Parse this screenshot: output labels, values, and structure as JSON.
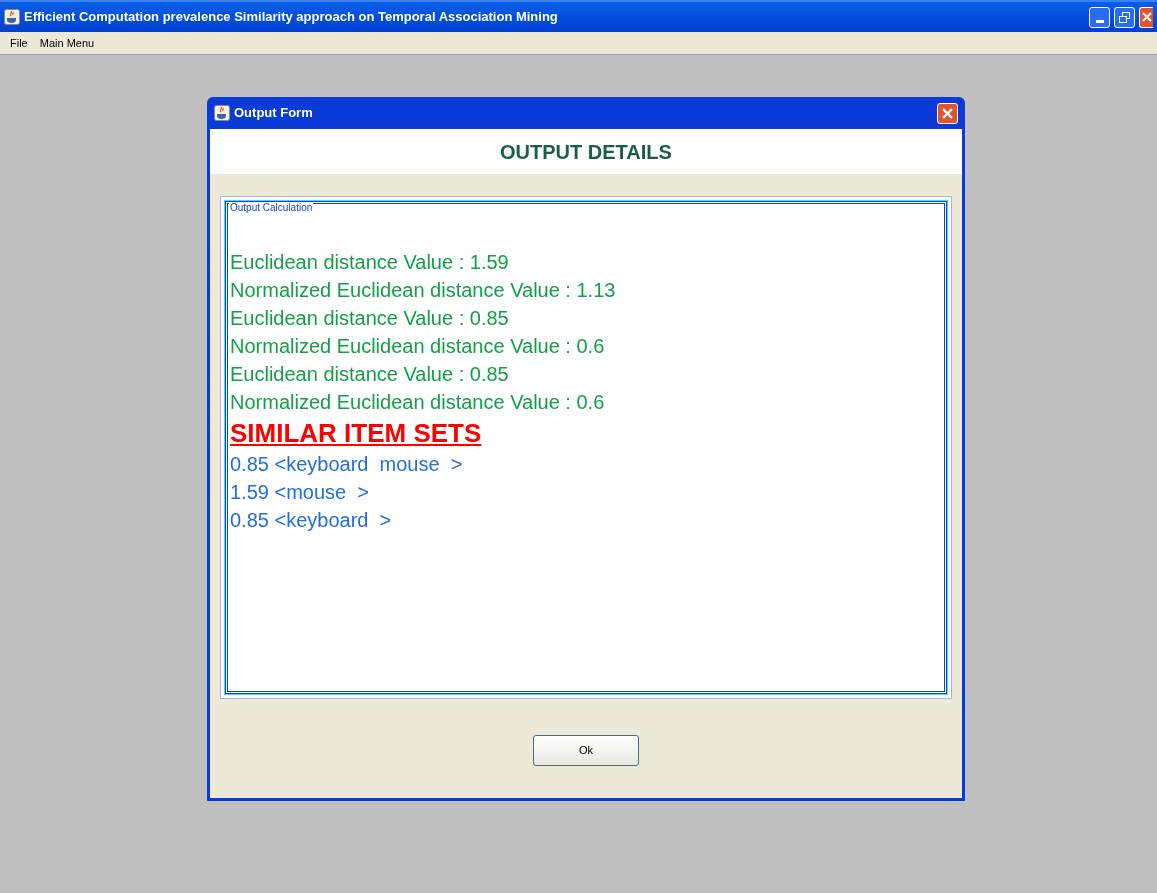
{
  "window": {
    "title": "Efficient Computation prevalence Similarity approach on Temporal Association Mining"
  },
  "menu": [
    "File",
    "Main Menu"
  ],
  "dialog": {
    "title": "Output Form",
    "heading": "OUTPUT DETAILS",
    "group_label": "Output Calculation",
    "lines": [
      {
        "kind": "result",
        "text": "Euclidean distance Value : 1.59"
      },
      {
        "kind": "result",
        "text": "Normalized Euclidean distance Value : 1.13"
      },
      {
        "kind": "result",
        "text": "Euclidean distance Value : 0.85"
      },
      {
        "kind": "result",
        "text": "Normalized Euclidean distance Value : 0.6"
      },
      {
        "kind": "result",
        "text": "Euclidean distance Value : 0.85"
      },
      {
        "kind": "result",
        "text": "Normalized Euclidean distance Value : 0.6"
      },
      {
        "kind": "heading",
        "text": "SIMILAR ITEM SETS"
      },
      {
        "kind": "item",
        "text": "0.85 <keyboard  mouse  >"
      },
      {
        "kind": "item",
        "text": "1.59 <mouse  >"
      },
      {
        "kind": "item",
        "text": "0.85 <keyboard  >"
      }
    ],
    "button": "Ok"
  }
}
